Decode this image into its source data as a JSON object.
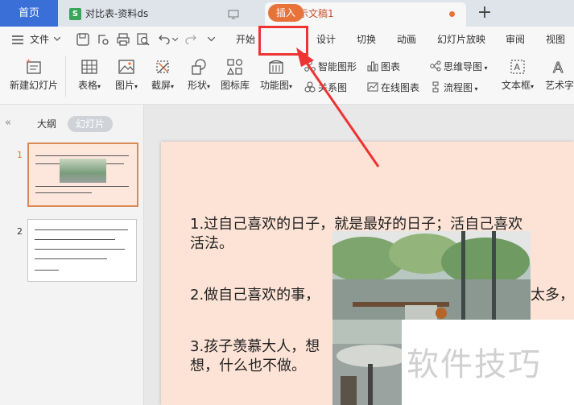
{
  "titlebar": {
    "home_tab": "首页",
    "tab1_label": "对比表-资料ds",
    "tab1_icon": "S",
    "tab2_label": "演示文稿1",
    "tab2_icon": "P",
    "new_tab": "+"
  },
  "menubar": {
    "file": "文件",
    "items": [
      "开始",
      "插入",
      "设计",
      "切换",
      "动画",
      "幻灯片放映",
      "审阅",
      "视图"
    ]
  },
  "ribbon": {
    "new_slide": "新建幻灯片",
    "table": "表格",
    "picture": "图片",
    "screenshot": "截屏",
    "shape": "形状",
    "icon_library": "图标库",
    "function_chart": "功能图",
    "smart_graphic": "智能图形",
    "chart": "图表",
    "relation_chart": "关系图",
    "online_chart": "在线图表",
    "mind_map": "思维导图",
    "flow_chart": "流程图",
    "text_box": "文本框",
    "word_art": "艺术字"
  },
  "leftpanel": {
    "outline_tab": "大纲",
    "slides_tab": "幻灯片",
    "slide_numbers": [
      "1",
      "2"
    ]
  },
  "slide": {
    "line1a": "1.过自己喜欢的日子，就是最好的日子；活自己喜欢",
    "line1b": "活法。",
    "line2a": "2.做自己喜欢的事，",
    "line2b": "太多，",
    "line3a": "3.孩子羡慕大人，想",
    "line3b": "想，什么也不做。"
  },
  "watermark": "软件技巧",
  "colors": {
    "accent": "#e8733a",
    "home_tab": "#3b6fd8",
    "highlight": "#e33333",
    "slide_bg": "#fde3d6"
  }
}
